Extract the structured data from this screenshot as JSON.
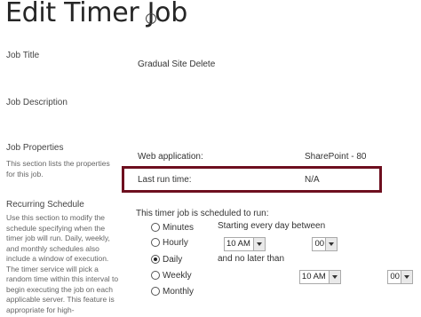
{
  "page": {
    "title": "Edit Timer Job",
    "info_icon": "info-icon"
  },
  "sections": {
    "job_title": {
      "label": "Job Title",
      "value": "Gradual Site Delete"
    },
    "job_description": {
      "label": "Job Description"
    },
    "job_properties": {
      "label": "Job Properties",
      "description": "This section lists the properties for this job.",
      "web_application_label": "Web application:",
      "web_application_value": "SharePoint - 80",
      "last_run_label": "Last run time:",
      "last_run_value": "N/A"
    },
    "recurring_schedule": {
      "label": "Recurring Schedule",
      "description": "Use this section to modify the schedule specifying when the timer job will run. Daily, weekly, and monthly schedules also include a window of execution. The timer service will pick a random time within this interval to begin executing the job on each applicable server. This feature is appropriate for high-",
      "intro": "This timer job is scheduled to run:",
      "options": [
        "Minutes",
        "Hourly",
        "Daily",
        "Weekly",
        "Monthly"
      ],
      "selected": "Daily",
      "start_label": "Starting every day between",
      "start_hour": "10 AM",
      "start_minute": "00",
      "end_label": "and no later than",
      "end_hour": "10 AM",
      "end_minute": "00"
    }
  },
  "colors": {
    "highlight_border": "#6e0f1f"
  }
}
